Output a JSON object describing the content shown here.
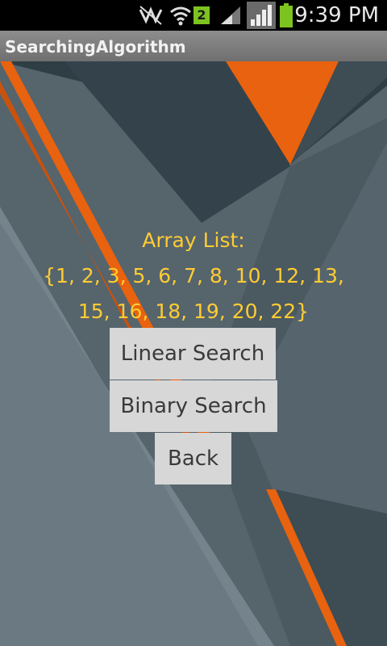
{
  "status_bar": {
    "time": "9:39 PM",
    "notification_badge": "2",
    "icons": [
      "no-sound-icon",
      "wifi-icon",
      "notification-badge-icon",
      "signal-icon",
      "signal-icon-2",
      "battery-icon"
    ],
    "battery_color": "#7dc31f"
  },
  "app": {
    "title": "SearchingAlgorithm"
  },
  "main": {
    "heading": "Array List:",
    "array_line1": "{1, 2, 3, 5, 6, 7, 8, 10, 12, 13,",
    "array_line2": "15, 16, 18, 19, 20, 22}",
    "text_color": "#ffcc33"
  },
  "buttons": {
    "linear_search": "Linear Search",
    "binary_search": "Binary Search",
    "back": "Back"
  },
  "colors": {
    "accent_orange": "#e8620f",
    "background_slate": "#55636b"
  }
}
